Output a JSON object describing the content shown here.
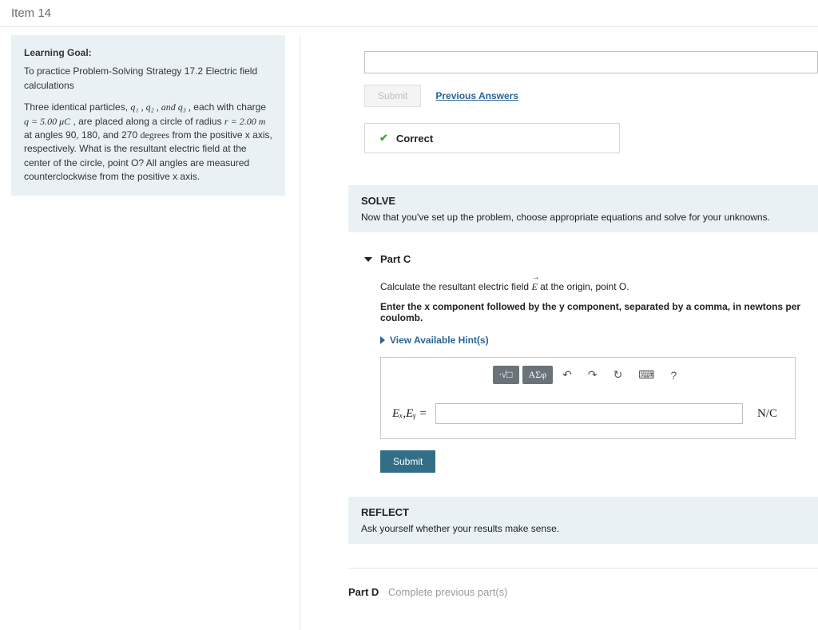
{
  "header": {
    "title": "Item 14"
  },
  "goal": {
    "heading": "Learning Goal:",
    "line1": "To practice Problem-Solving Strategy 17.2 Electric field calculations",
    "problem_pre": "Three identical particles, ",
    "q_list": "q₁ , q₂ , and q₃ ,",
    "problem_mid1": " each with charge ",
    "qval": "q = 5.00 μC",
    "problem_mid2": " , are placed along a circle of radius ",
    "rval": "r = 2.00 m",
    "problem_mid3": " at angles 90, 180, and 270 ",
    "deg": "degrees",
    "problem_tail": " from the positive x axis, respectively. What is the resultant electric field at the center of the circle, point O? All angles are measured counterclockwise from the positive x axis."
  },
  "prev": {
    "submit": "Submit",
    "prev_answers": "Previous Answers",
    "correct": "Correct"
  },
  "solve": {
    "title": "SOLVE",
    "desc": "Now that you've set up the problem, choose appropriate equations and solve for your unknowns."
  },
  "partC": {
    "title": "Part C",
    "prompt_pre": "Calculate the resultant electric field ",
    "prompt_post": " at the origin, point O.",
    "instruction": "Enter the x component followed by the y component, separated by a comma, in newtons per coulomb.",
    "hints": "View Available Hint(s)",
    "tool_math": "∙√□",
    "tool_greek": "ΑΣφ",
    "tool_undo": "↶",
    "tool_redo": "↷",
    "tool_reset": "↻",
    "tool_keyboard": "⌨",
    "tool_help": "?",
    "answer_label": "Eₓ,Eᵧ =",
    "answer_unit": "N/C",
    "submit": "Submit"
  },
  "reflect": {
    "title": "REFLECT",
    "desc": "Ask yourself whether your results make sense."
  },
  "partD": {
    "title": "Part D",
    "status": "Complete previous part(s)"
  }
}
